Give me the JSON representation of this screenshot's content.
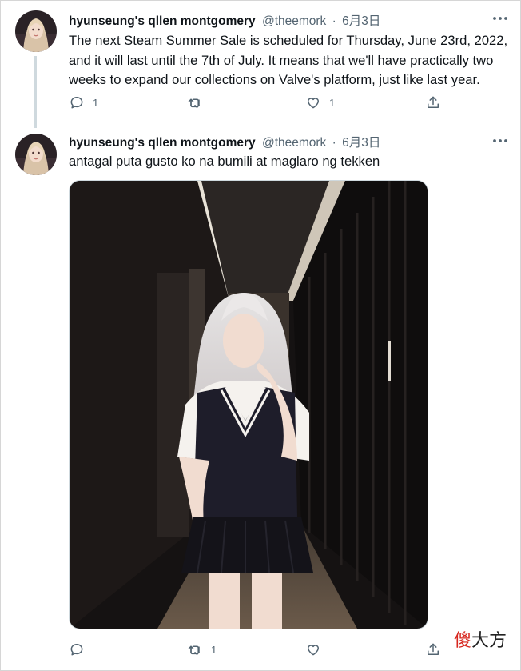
{
  "tweets": [
    {
      "display_name": "hyunseung's qllen montgomery",
      "handle": "@theemork",
      "separator": "·",
      "date": "6月3日",
      "text": "The next Steam Summer Sale is scheduled for Thursday, June 23rd, 2022, and it will last until the 7th of July. It means that we'll have practically two weeks to expand our collections on Valve's platform, just like last year.",
      "actions": {
        "reply_count": "1",
        "retweet_count": "",
        "like_count": "1"
      }
    },
    {
      "display_name": "hyunseung's qllen montgomery",
      "handle": "@theemork",
      "separator": "·",
      "date": "6月3日",
      "text": "antagal puta gusto ko na bumili at maglaro ng tekken",
      "actions": {
        "reply_count": "",
        "retweet_count": "1",
        "like_count": ""
      }
    }
  ],
  "watermark": {
    "red_part": "傻",
    "dark_part": "大方"
  },
  "colors": {
    "text": "#0f1419",
    "secondary": "#536471",
    "thread_line": "#cfd9de",
    "watermark_red": "#d7261e"
  },
  "icons": [
    "reply-icon",
    "retweet-icon",
    "like-icon",
    "share-icon",
    "more-icon"
  ]
}
